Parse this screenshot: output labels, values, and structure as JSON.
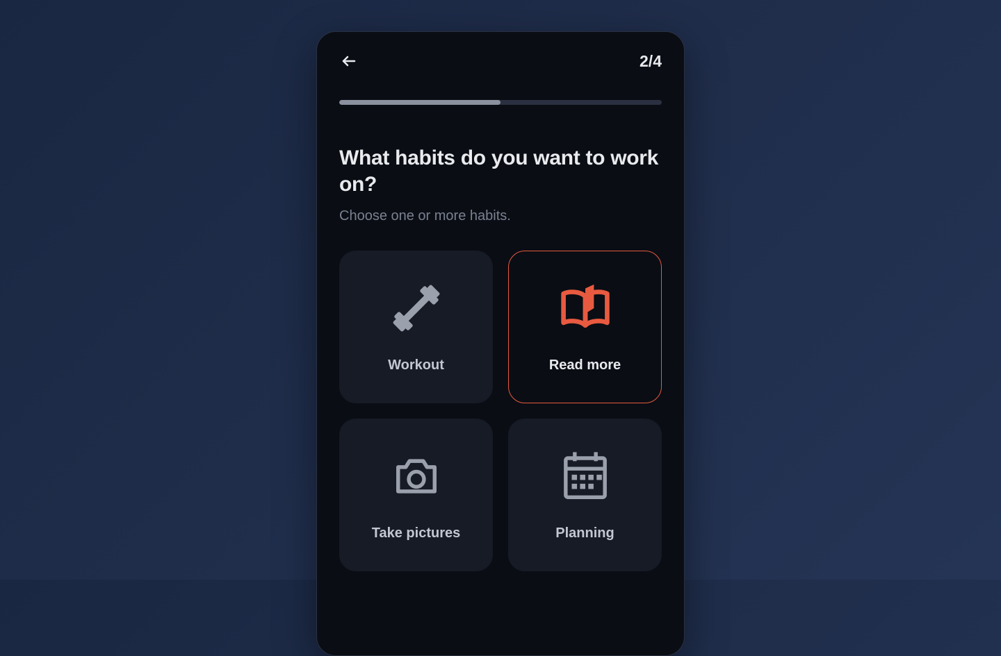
{
  "header": {
    "step_counter": "2/4",
    "progress_percent": 50
  },
  "content": {
    "heading": "What habits do you want to work on?",
    "subheading": "Choose one or more habits."
  },
  "habits": [
    {
      "label": "Workout",
      "icon": "dumbbell-icon",
      "selected": false
    },
    {
      "label": "Read more",
      "icon": "book-icon",
      "selected": true
    },
    {
      "label": "Take pictures",
      "icon": "camera-icon",
      "selected": false
    },
    {
      "label": "Planning",
      "icon": "calendar-icon",
      "selected": false
    }
  ],
  "colors": {
    "accent": "#e85a40",
    "icon_muted": "#9aa0ac"
  }
}
